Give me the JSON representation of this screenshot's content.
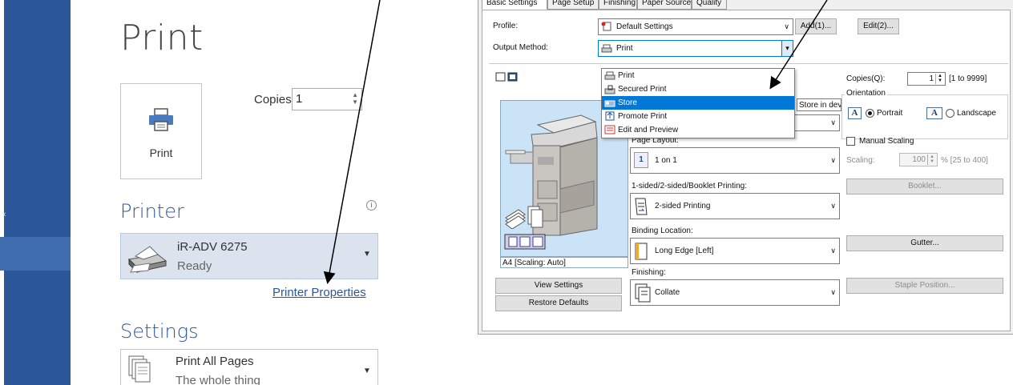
{
  "backstage": {
    "title": "Print",
    "print_button": "Print",
    "copies_label": "Copies:",
    "copies_value": "1",
    "printer_heading": "Printer",
    "printer_name": "iR-ADV 6275",
    "printer_status": "Ready",
    "printer_properties": "Printer Properties",
    "settings_heading": "Settings",
    "print_range_title": "Print All Pages",
    "print_range_desc": "The whole thing"
  },
  "driver": {
    "tabs": [
      "Basic Settings",
      "Page Setup",
      "Finishing",
      "Paper Source",
      "Quality"
    ],
    "profile_label": "Profile:",
    "profile_value": "Default Settings",
    "add_button": "Add(1)...",
    "edit_button": "Edit(2)...",
    "output_label": "Output Method:",
    "output_value": "Print",
    "output_options": [
      "Print",
      "Secured Print",
      "Store",
      "Promote Print",
      "Edit and Preview"
    ],
    "highlighted_option": "Store",
    "tooltip": "Store in device.",
    "preview_caption": "A4 [Scaling: Auto]",
    "copies_label": "Copies(Q):",
    "copies_value": "1",
    "copies_range": "[1 to 9999]",
    "orientation_label": "Orientation",
    "portrait": "Portrait",
    "landscape": "Landscape",
    "orient_glyph": "A",
    "page_layout_label": "Page Layout:",
    "page_layout_num": "1",
    "page_layout_value": "1 on 1",
    "manual_scaling": "Manual Scaling",
    "scaling_label": "Scaling:",
    "scaling_value": "100",
    "scaling_range": "% [25 to 400]",
    "booklet_button": "Booklet...",
    "sided_label": "1-sided/2-sided/Booklet Printing:",
    "sided_value": "2-sided Printing",
    "binding_label": "Binding Location:",
    "binding_value": "Long Edge [Left]",
    "gutter_button": "Gutter...",
    "finishing_label": "Finishing:",
    "finishing_value": "Collate",
    "staple_button": "Staple Position...",
    "view_settings_button": "View Settings",
    "restore_defaults_button": "Restore Defaults"
  },
  "colors": {
    "word_blue": "#2b579a",
    "highlight": "#0078d7"
  }
}
